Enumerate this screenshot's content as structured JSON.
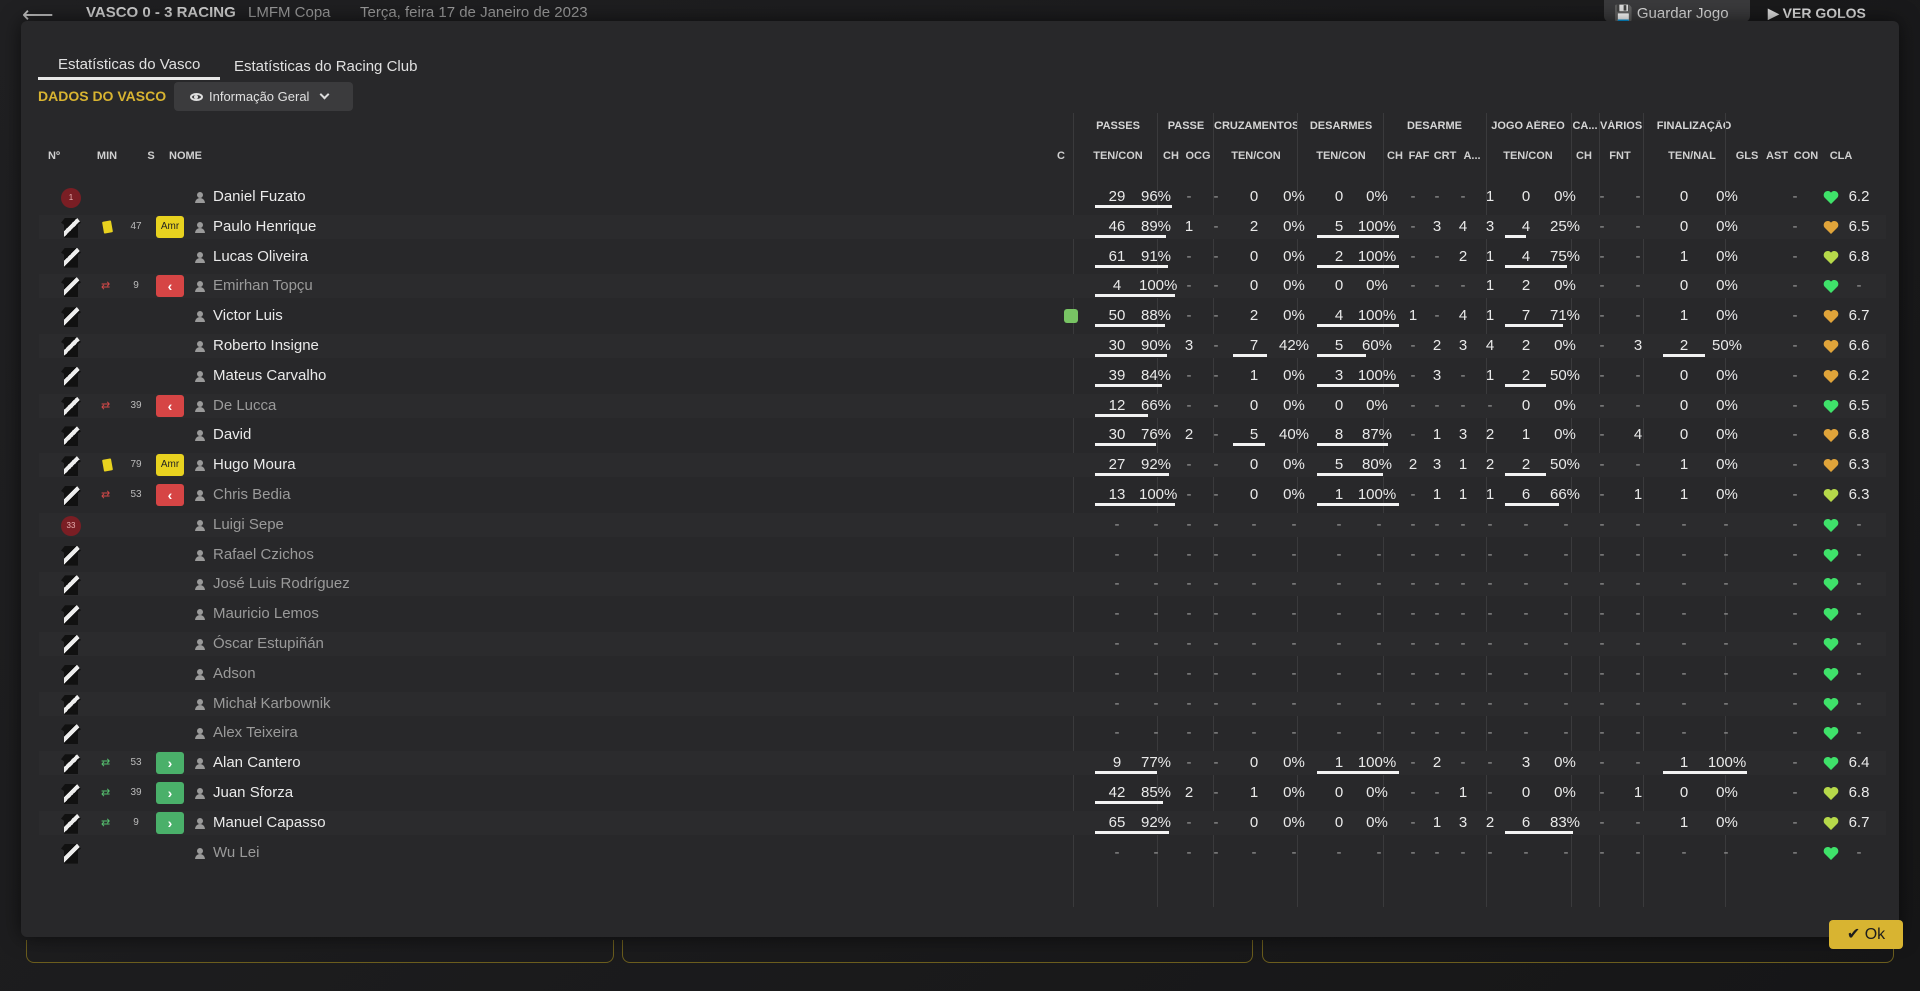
{
  "topbar": {
    "match": "VASCO   0 - 3   RACING",
    "competition": "LMFM Copa",
    "date": "Terça, feira 17 de Janeiro de 2023",
    "save_label": "Guardar Jogo",
    "goals_label": "VER GOLOS"
  },
  "tabs": [
    {
      "label": "Estatísticas do Vasco",
      "active": true
    },
    {
      "label": "Estatísticas do Racing Club",
      "active": false
    }
  ],
  "team_label": "DADOS DO VASCO",
  "dropdown": {
    "label": "Informação Geral"
  },
  "groups": {
    "passes": "PASSES",
    "passe": "PASSE",
    "cruzamentos": "CRUZAMENTOS",
    "desarmes": "DESARMES",
    "desarme": "DESARME",
    "jogo_aereo": "JOGO AÉREO",
    "ca": "CA...",
    "varios": "VÁRIOS",
    "finalizacao": "FINALIZAÇÃO"
  },
  "columns": {
    "no": "Nº",
    "min": "MIN",
    "s": "S",
    "nome": "NOME",
    "c": "C",
    "passes": "TEN/CON",
    "passe_ch": "CH",
    "passe_ocg": "OCG",
    "cruz": "TEN/CON",
    "desarmes": "TEN/CON",
    "d_ch": "CH",
    "d_faf": "FAF",
    "d_crt": "CRT",
    "d_a": "A...",
    "aereo": "TEN/CON",
    "ca_ch": "CH",
    "fnt": "FNT",
    "fin": "TEN/NAL",
    "gls": "GLS",
    "ast": "AST",
    "con": "CON",
    "cla": "CLA"
  },
  "heart_colors": {
    "green": "#3fe26a",
    "yellowgreen": "#b6d94a",
    "orange": "#e0a43a"
  },
  "players": [
    {
      "no": "1",
      "kit": "gk",
      "min": "",
      "card": "",
      "status": "",
      "name": "Daniel Fuzato",
      "dim": false,
      "cap": false,
      "p1": "29",
      "p2": "96%",
      "pb": 0.96,
      "pch": "-",
      "pocg": "-",
      "c1": "0",
      "c2": "0%",
      "cb": 0,
      "d1": "0",
      "d2": "0%",
      "db": 0,
      "dch": "-",
      "dfaf": "-",
      "dcrt": "-",
      "da": "1",
      "a1": "0",
      "a2": "0%",
      "ab": 0,
      "cach": "-",
      "fnt": "-",
      "f1": "0",
      "f2": "0%",
      "fb": 0,
      "gls": "",
      "ast": "-",
      "con": "green",
      "cla": "6.2"
    },
    {
      "no": "",
      "kit": "kit",
      "min": "47",
      "card": "yellow",
      "status": "amr",
      "status_label": "Amr",
      "name": "Paulo Henrique",
      "dim": false,
      "cap": false,
      "p1": "46",
      "p2": "89%",
      "pb": 0.89,
      "pch": "1",
      "pocg": "-",
      "c1": "2",
      "c2": "0%",
      "cb": 0,
      "d1": "5",
      "d2": "100%",
      "db": 1,
      "dch": "-",
      "dfaf": "3",
      "dcrt": "4",
      "da": "3",
      "a1": "4",
      "a2": "25%",
      "ab": 0.25,
      "cach": "-",
      "fnt": "-",
      "f1": "0",
      "f2": "0%",
      "fb": 0,
      "gls": "",
      "ast": "-",
      "con": "orange",
      "cla": "6.5"
    },
    {
      "no": "",
      "kit": "kit",
      "min": "",
      "card": "",
      "status": "",
      "name": "Lucas Oliveira",
      "dim": false,
      "cap": false,
      "p1": "61",
      "p2": "91%",
      "pb": 0.91,
      "pch": "-",
      "pocg": "-",
      "c1": "0",
      "c2": "0%",
      "cb": 0,
      "d1": "2",
      "d2": "100%",
      "db": 1,
      "dch": "-",
      "dfaf": "-",
      "dcrt": "2",
      "da": "1",
      "a1": "4",
      "a2": "75%",
      "ab": 0.75,
      "cach": "-",
      "fnt": "-",
      "f1": "1",
      "f2": "0%",
      "fb": 0,
      "gls": "",
      "ast": "-",
      "con": "yellowgreen",
      "cla": "6.8"
    },
    {
      "no": "",
      "kit": "kit",
      "min": "9",
      "card": "",
      "sub": "out",
      "status": "out",
      "status_label": "‹",
      "name": "Emirhan Topçu",
      "dim": true,
      "cap": false,
      "p1": "4",
      "p2": "100%",
      "pb": 1,
      "pch": "-",
      "pocg": "-",
      "c1": "0",
      "c2": "0%",
      "cb": 0,
      "d1": "0",
      "d2": "0%",
      "db": 0,
      "dch": "-",
      "dfaf": "-",
      "dcrt": "-",
      "da": "1",
      "a1": "2",
      "a2": "0%",
      "ab": 0,
      "cach": "-",
      "fnt": "-",
      "f1": "0",
      "f2": "0%",
      "fb": 0,
      "gls": "",
      "ast": "-",
      "con": "green",
      "cla": "-"
    },
    {
      "no": "",
      "kit": "kit",
      "min": "",
      "card": "",
      "status": "",
      "name": "Victor Luis",
      "dim": false,
      "cap": true,
      "p1": "50",
      "p2": "88%",
      "pb": 0.88,
      "pch": "-",
      "pocg": "-",
      "c1": "2",
      "c2": "0%",
      "cb": 0,
      "d1": "4",
      "d2": "100%",
      "db": 1,
      "dch": "1",
      "dfaf": "-",
      "dcrt": "4",
      "da": "1",
      "a1": "7",
      "a2": "71%",
      "ab": 0.71,
      "cach": "-",
      "fnt": "-",
      "f1": "1",
      "f2": "0%",
      "fb": 0,
      "gls": "",
      "ast": "-",
      "con": "orange",
      "cla": "6.7"
    },
    {
      "no": "",
      "kit": "kit",
      "min": "",
      "card": "",
      "status": "",
      "name": "Roberto Insigne",
      "dim": false,
      "cap": false,
      "p1": "30",
      "p2": "90%",
      "pb": 0.9,
      "pch": "3",
      "pocg": "-",
      "c1": "7",
      "c2": "42%",
      "cb": 0.42,
      "d1": "5",
      "d2": "60%",
      "db": 0.6,
      "dch": "-",
      "dfaf": "2",
      "dcrt": "3",
      "da": "4",
      "a1": "2",
      "a2": "0%",
      "ab": 0,
      "cach": "-",
      "fnt": "3",
      "f1": "2",
      "f2": "50%",
      "fb": 0.5,
      "gls": "",
      "ast": "-",
      "con": "orange",
      "cla": "6.6"
    },
    {
      "no": "",
      "kit": "kit",
      "min": "",
      "card": "",
      "status": "",
      "name": "Mateus Carvalho",
      "dim": false,
      "cap": false,
      "p1": "39",
      "p2": "84%",
      "pb": 0.84,
      "pch": "-",
      "pocg": "-",
      "c1": "1",
      "c2": "0%",
      "cb": 0,
      "d1": "3",
      "d2": "100%",
      "db": 1,
      "dch": "-",
      "dfaf": "3",
      "dcrt": "-",
      "da": "1",
      "a1": "2",
      "a2": "50%",
      "ab": 0.5,
      "cach": "-",
      "fnt": "-",
      "f1": "0",
      "f2": "0%",
      "fb": 0,
      "gls": "",
      "ast": "-",
      "con": "orange",
      "cla": "6.2"
    },
    {
      "no": "",
      "kit": "kit",
      "min": "39",
      "card": "",
      "sub": "out",
      "status": "out",
      "status_label": "‹",
      "name": "De Lucca",
      "dim": true,
      "cap": false,
      "p1": "12",
      "p2": "66%",
      "pb": 0.66,
      "pch": "-",
      "pocg": "-",
      "c1": "0",
      "c2": "0%",
      "cb": 0,
      "d1": "0",
      "d2": "0%",
      "db": 0,
      "dch": "-",
      "dfaf": "-",
      "dcrt": "-",
      "da": "-",
      "a1": "0",
      "a2": "0%",
      "ab": 0,
      "cach": "-",
      "fnt": "-",
      "f1": "0",
      "f2": "0%",
      "fb": 0,
      "gls": "",
      "ast": "-",
      "con": "green",
      "cla": "6.5"
    },
    {
      "no": "",
      "kit": "kit",
      "min": "",
      "card": "",
      "status": "",
      "name": "David",
      "dim": false,
      "cap": false,
      "p1": "30",
      "p2": "76%",
      "pb": 0.76,
      "pch": "2",
      "pocg": "-",
      "c1": "5",
      "c2": "40%",
      "cb": 0.4,
      "d1": "8",
      "d2": "87%",
      "db": 0.87,
      "dch": "-",
      "dfaf": "1",
      "dcrt": "3",
      "da": "2",
      "a1": "1",
      "a2": "0%",
      "ab": 0,
      "cach": "-",
      "fnt": "4",
      "f1": "0",
      "f2": "0%",
      "fb": 0,
      "gls": "",
      "ast": "-",
      "con": "orange",
      "cla": "6.8"
    },
    {
      "no": "",
      "kit": "kit",
      "min": "79",
      "card": "yellow",
      "status": "amr",
      "status_label": "Amr",
      "name": "Hugo Moura",
      "dim": false,
      "cap": false,
      "p1": "27",
      "p2": "92%",
      "pb": 0.92,
      "pch": "-",
      "pocg": "-",
      "c1": "0",
      "c2": "0%",
      "cb": 0,
      "d1": "5",
      "d2": "80%",
      "db": 0.8,
      "dch": "2",
      "dfaf": "3",
      "dcrt": "1",
      "da": "2",
      "a1": "2",
      "a2": "50%",
      "ab": 0.5,
      "cach": "-",
      "fnt": "-",
      "f1": "1",
      "f2": "0%",
      "fb": 0,
      "gls": "",
      "ast": "-",
      "con": "orange",
      "cla": "6.3"
    },
    {
      "no": "",
      "kit": "kit",
      "min": "53",
      "card": "",
      "sub": "out",
      "status": "out",
      "status_label": "‹",
      "name": "Chris Bedia",
      "dim": true,
      "cap": false,
      "p1": "13",
      "p2": "100%",
      "pb": 1,
      "pch": "-",
      "pocg": "-",
      "c1": "0",
      "c2": "0%",
      "cb": 0,
      "d1": "1",
      "d2": "100%",
      "db": 1,
      "dch": "-",
      "dfaf": "1",
      "dcrt": "1",
      "da": "1",
      "a1": "6",
      "a2": "66%",
      "ab": 0.66,
      "cach": "-",
      "fnt": "1",
      "f1": "1",
      "f2": "0%",
      "fb": 0,
      "gls": "",
      "ast": "-",
      "con": "yellowgreen",
      "cla": "6.3"
    },
    {
      "no": "33",
      "kit": "gk",
      "min": "",
      "card": "",
      "status": "",
      "name": "Luigi Sepe",
      "dim": true,
      "cap": false,
      "empty": true,
      "con": "green",
      "cla": "-"
    },
    {
      "no": "",
      "kit": "kit",
      "min": "",
      "card": "",
      "status": "",
      "name": "Rafael Czichos",
      "dim": true,
      "cap": false,
      "empty": true,
      "con": "green",
      "cla": "-"
    },
    {
      "no": "",
      "kit": "kit",
      "min": "",
      "card": "",
      "status": "",
      "name": "José Luis Rodríguez",
      "dim": true,
      "cap": false,
      "empty": true,
      "con": "green",
      "cla": "-"
    },
    {
      "no": "",
      "kit": "kit",
      "min": "",
      "card": "",
      "status": "",
      "name": "Mauricio Lemos",
      "dim": true,
      "cap": false,
      "empty": true,
      "con": "green",
      "cla": "-"
    },
    {
      "no": "",
      "kit": "kit",
      "min": "",
      "card": "",
      "status": "",
      "name": "Óscar Estupiñán",
      "dim": true,
      "cap": false,
      "empty": true,
      "con": "green",
      "cla": "-"
    },
    {
      "no": "",
      "kit": "kit",
      "min": "",
      "card": "",
      "status": "",
      "name": "Adson",
      "dim": true,
      "cap": false,
      "empty": true,
      "con": "green",
      "cla": "-"
    },
    {
      "no": "",
      "kit": "kit",
      "min": "",
      "card": "",
      "status": "",
      "name": "Michał Karbownik",
      "dim": true,
      "cap": false,
      "empty": true,
      "con": "green",
      "cla": "-"
    },
    {
      "no": "",
      "kit": "kit",
      "min": "",
      "card": "",
      "status": "",
      "name": "Alex Teixeira",
      "dim": true,
      "cap": false,
      "empty": true,
      "con": "green",
      "cla": "-"
    },
    {
      "no": "",
      "kit": "kit",
      "min": "53",
      "card": "",
      "sub": "in",
      "status": "in",
      "status_label": "›",
      "name": "Alan Cantero",
      "dim": false,
      "cap": false,
      "p1": "9",
      "p2": "77%",
      "pb": 0.77,
      "pch": "-",
      "pocg": "-",
      "c1": "0",
      "c2": "0%",
      "cb": 0,
      "d1": "1",
      "d2": "100%",
      "db": 1,
      "dch": "-",
      "dfaf": "2",
      "dcrt": "-",
      "da": "-",
      "a1": "3",
      "a2": "0%",
      "ab": 0,
      "cach": "-",
      "fnt": "-",
      "f1": "1",
      "f2": "100%",
      "fb": 1,
      "gls": "",
      "ast": "-",
      "con": "green",
      "cla": "6.4"
    },
    {
      "no": "",
      "kit": "kit",
      "min": "39",
      "card": "",
      "sub": "in",
      "status": "in",
      "status_label": "›",
      "name": "Juan Sforza",
      "dim": false,
      "cap": false,
      "p1": "42",
      "p2": "85%",
      "pb": 0.85,
      "pch": "2",
      "pocg": "-",
      "c1": "1",
      "c2": "0%",
      "cb": 0,
      "d1": "0",
      "d2": "0%",
      "db": 0,
      "dch": "-",
      "dfaf": "-",
      "dcrt": "1",
      "da": "-",
      "a1": "0",
      "a2": "0%",
      "ab": 0,
      "cach": "-",
      "fnt": "1",
      "f1": "0",
      "f2": "0%",
      "fb": 0,
      "gls": "",
      "ast": "-",
      "con": "yellowgreen",
      "cla": "6.8"
    },
    {
      "no": "",
      "kit": "kit",
      "min": "9",
      "card": "",
      "sub": "in",
      "status": "in",
      "status_label": "›",
      "name": "Manuel Capasso",
      "dim": false,
      "cap": false,
      "p1": "65",
      "p2": "92%",
      "pb": 0.92,
      "pch": "-",
      "pocg": "-",
      "c1": "0",
      "c2": "0%",
      "cb": 0,
      "d1": "0",
      "d2": "0%",
      "db": 0,
      "dch": "-",
      "dfaf": "1",
      "dcrt": "3",
      "da": "2",
      "a1": "6",
      "a2": "83%",
      "ab": 0.83,
      "cach": "-",
      "fnt": "-",
      "f1": "1",
      "f2": "0%",
      "fb": 0,
      "gls": "",
      "ast": "-",
      "con": "yellowgreen",
      "cla": "6.7"
    },
    {
      "no": "",
      "kit": "kit",
      "min": "",
      "card": "",
      "status": "",
      "name": "Wu Lei",
      "dim": true,
      "cap": false,
      "empty": true,
      "con": "green",
      "cla": "-"
    }
  ],
  "ok_label": "Ok"
}
